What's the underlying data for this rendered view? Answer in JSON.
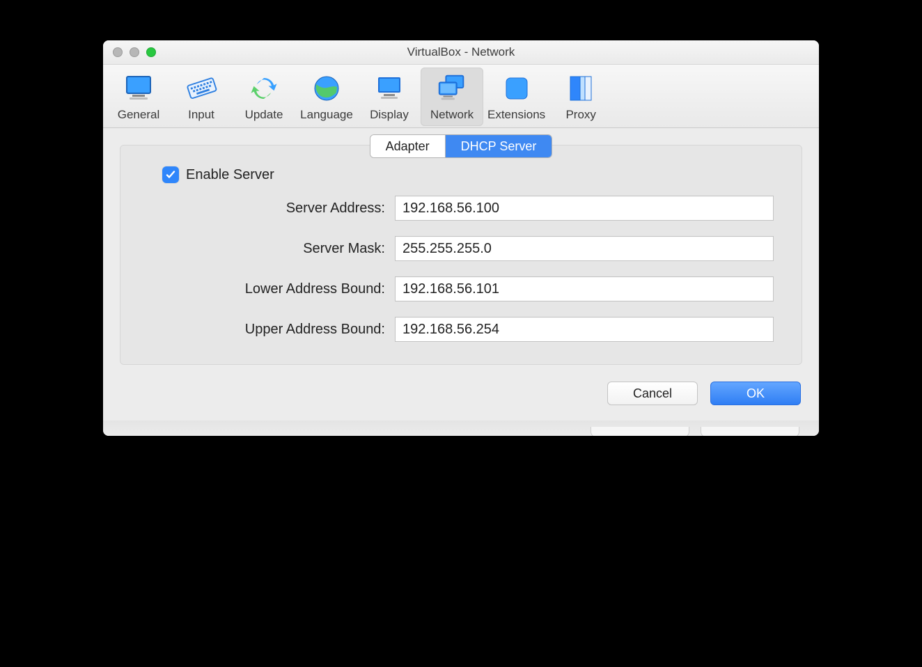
{
  "window": {
    "title": "VirtualBox - Network"
  },
  "toolbar": {
    "items": [
      {
        "label": "General"
      },
      {
        "label": "Input"
      },
      {
        "label": "Update"
      },
      {
        "label": "Language"
      },
      {
        "label": "Display"
      },
      {
        "label": "Network",
        "selected": true
      },
      {
        "label": "Extensions"
      },
      {
        "label": "Proxy"
      }
    ]
  },
  "tabs": {
    "items": [
      {
        "label": "Adapter",
        "active": false
      },
      {
        "label": "DHCP Server",
        "active": true
      }
    ]
  },
  "form": {
    "enable_label": "Enable Server",
    "enable_checked": true,
    "fields": {
      "server_address": {
        "label": "Server Address:",
        "value": "192.168.56.100"
      },
      "server_mask": {
        "label": "Server Mask:",
        "value": "255.255.255.0"
      },
      "lower_bound": {
        "label": "Lower Address Bound:",
        "value": "192.168.56.101"
      },
      "upper_bound": {
        "label": "Upper Address Bound:",
        "value": "192.168.56.254"
      }
    }
  },
  "footer": {
    "cancel": "Cancel",
    "ok": "OK"
  }
}
